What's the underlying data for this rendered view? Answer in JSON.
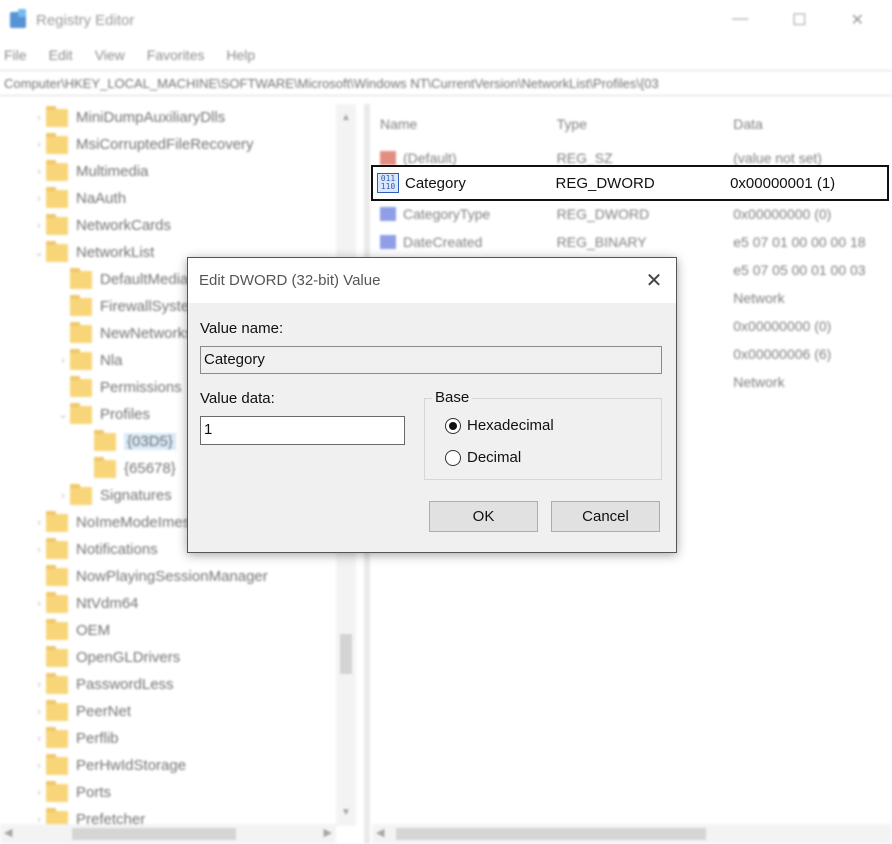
{
  "window": {
    "title": "Registry Editor",
    "controls": [
      "—",
      "☐",
      "✕"
    ]
  },
  "menu": [
    "File",
    "Edit",
    "View",
    "Favorites",
    "Help"
  ],
  "address": "Computer\\HKEY_LOCAL_MACHINE\\SOFTWARE\\Microsoft\\Windows NT\\CurrentVersion\\NetworkList\\Profiles\\{03",
  "tree": [
    {
      "label": "MiniDumpAuxiliaryDlls",
      "indent": 0,
      "arrow": "›"
    },
    {
      "label": "MsiCorruptedFileRecovery",
      "indent": 0,
      "arrow": "›"
    },
    {
      "label": "Multimedia",
      "indent": 0,
      "arrow": "›"
    },
    {
      "label": "NaAuth",
      "indent": 0,
      "arrow": "›"
    },
    {
      "label": "NetworkCards",
      "indent": 0,
      "arrow": "›"
    },
    {
      "label": "NetworkList",
      "indent": 0,
      "arrow": "⌄"
    },
    {
      "label": "DefaultMediaCost",
      "indent": 1,
      "arrow": ""
    },
    {
      "label": "FirewallSystem",
      "indent": 1,
      "arrow": ""
    },
    {
      "label": "NewNetworks",
      "indent": 1,
      "arrow": ""
    },
    {
      "label": "Nla",
      "indent": 1,
      "arrow": "›"
    },
    {
      "label": "Permissions",
      "indent": 1,
      "arrow": ""
    },
    {
      "label": "Profiles",
      "indent": 1,
      "arrow": "⌄"
    },
    {
      "label": "{03D5}",
      "indent": 2,
      "arrow": "",
      "selected": true
    },
    {
      "label": "{65678}",
      "indent": 2,
      "arrow": ""
    },
    {
      "label": "Signatures",
      "indent": 1,
      "arrow": "›"
    },
    {
      "label": "NoImeModeImes",
      "indent": 0,
      "arrow": "›"
    },
    {
      "label": "Notifications",
      "indent": 0,
      "arrow": "›"
    },
    {
      "label": "NowPlayingSessionManager",
      "indent": 0,
      "arrow": ""
    },
    {
      "label": "NtVdm64",
      "indent": 0,
      "arrow": "›"
    },
    {
      "label": "OEM",
      "indent": 0,
      "arrow": ""
    },
    {
      "label": "OpenGLDrivers",
      "indent": 0,
      "arrow": ""
    },
    {
      "label": "PasswordLess",
      "indent": 0,
      "arrow": "›"
    },
    {
      "label": "PeerNet",
      "indent": 0,
      "arrow": "›"
    },
    {
      "label": "Perflib",
      "indent": 0,
      "arrow": "›"
    },
    {
      "label": "PerHwIdStorage",
      "indent": 0,
      "arrow": "›"
    },
    {
      "label": "Ports",
      "indent": 0,
      "arrow": "›"
    },
    {
      "label": "Prefetcher",
      "indent": 0,
      "arrow": "›"
    }
  ],
  "columns": {
    "name": "Name",
    "type": "Type",
    "data": "Data"
  },
  "values": [
    {
      "name": "(Default)",
      "type": "REG_SZ",
      "data": "(value not set)",
      "icon": "sz"
    },
    {
      "name": "Category",
      "type": "REG_DWORD",
      "data": "0x00000001 (1)",
      "icon": "dword",
      "highlighted": true
    },
    {
      "name": "CategoryType",
      "type": "REG_DWORD",
      "data": "0x00000000 (0)",
      "icon": "dword"
    },
    {
      "name": "DateCreated",
      "type": "REG_BINARY",
      "data": "e5 07 01 00 00 00 18",
      "icon": "bin"
    },
    {
      "name": "",
      "type": "",
      "data": "e5 07 05 00 01 00 03",
      "icon": ""
    },
    {
      "name": "",
      "type": "",
      "data": "Network",
      "icon": ""
    },
    {
      "name": "",
      "type": "",
      "data": "0x00000000 (0)",
      "icon": ""
    },
    {
      "name": "",
      "type": "",
      "data": "0x00000006 (6)",
      "icon": ""
    },
    {
      "name": "",
      "type": "",
      "data": "Network",
      "icon": ""
    }
  ],
  "dword_icon_text": "011\n110",
  "dialog": {
    "title": "Edit DWORD (32-bit) Value",
    "close": "✕",
    "value_name_label": "Value name:",
    "value_name": "Category",
    "value_data_label": "Value data:",
    "value_data": "1",
    "base_label": "Base",
    "hex_label": "Hexadecimal",
    "dec_label": "Decimal",
    "ok_label": "OK",
    "cancel_label": "Cancel"
  }
}
